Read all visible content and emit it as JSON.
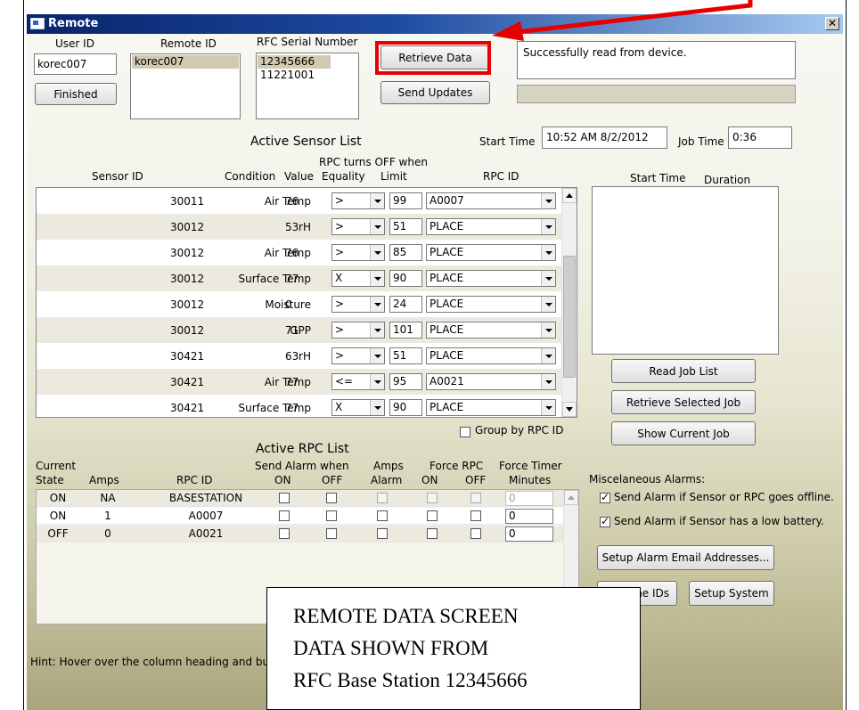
{
  "window": {
    "title": "Remote",
    "close_glyph": "✕"
  },
  "user": {
    "label": "User ID",
    "value": "korec007",
    "finished_label": "Finished"
  },
  "remote": {
    "label": "Remote ID",
    "items": [
      "korec007"
    ]
  },
  "rfc": {
    "label": "RFC Serial Number",
    "items": [
      "12345666",
      "11221001"
    ]
  },
  "buttons": {
    "retrieve": "Retrieve Data",
    "send": "Send Updates"
  },
  "status": {
    "message": "Successfully read from device."
  },
  "time": {
    "start_label": "Start Time",
    "start_value": "10:52 AM 8/2/2012",
    "job_label": "Job Time",
    "job_value": "0:36"
  },
  "sensor": {
    "title": "Active Sensor List",
    "header": {
      "id": "Sensor ID",
      "condition": "Condition",
      "value": "Value",
      "equality": "Equality",
      "limit": "Limit",
      "rpc": "RPC ID",
      "rpc_off": "RPC turns OFF when"
    },
    "rows": [
      {
        "id": "30011",
        "condition": "Air Temp",
        "value": "76",
        "equality": ">",
        "limit": "99",
        "rpc": "A0007"
      },
      {
        "id": "30012",
        "condition": "rH",
        "value": "53",
        "equality": ">",
        "limit": "51",
        "rpc": "PLACE"
      },
      {
        "id": "30012",
        "condition": "Air Temp",
        "value": "76",
        "equality": ">",
        "limit": "85",
        "rpc": "PLACE"
      },
      {
        "id": "30012",
        "condition": "Surface Temp",
        "value": "77",
        "equality": "X",
        "limit": "90",
        "rpc": "PLACE"
      },
      {
        "id": "30012",
        "condition": "Moisture",
        "value": "0",
        "equality": ">",
        "limit": "24",
        "rpc": "PLACE"
      },
      {
        "id": "30012",
        "condition": "GPP",
        "value": "71",
        "equality": ">",
        "limit": "101",
        "rpc": "PLACE"
      },
      {
        "id": "30421",
        "condition": "rH",
        "value": "63",
        "equality": ">",
        "limit": "51",
        "rpc": "PLACE"
      },
      {
        "id": "30421",
        "condition": "Air Temp",
        "value": "77",
        "equality": "<=",
        "limit": "95",
        "rpc": "A0021"
      },
      {
        "id": "30421",
        "condition": "Surface Temp",
        "value": "77",
        "equality": "X",
        "limit": "90",
        "rpc": "PLACE"
      }
    ],
    "group_label": "Group by RPC ID"
  },
  "jobs": {
    "start_header": "Start Time",
    "duration_header": "Duration",
    "read_label": "Read Job List",
    "retrieve_label": "Retrieve Selected Job",
    "show_label": "Show Current Job"
  },
  "rpc": {
    "title": "Active RPC List",
    "header": {
      "current": "Current",
      "state": "State",
      "amps": "Amps",
      "rpc_id": "RPC ID",
      "send_alarm": "Send Alarm when",
      "on": "ON",
      "off": "OFF",
      "amps_top": "Amps",
      "alarm": "Alarm",
      "force_rpc": "Force RPC",
      "force_on": "ON",
      "force_off": "OFF",
      "force_timer": "Force Timer",
      "minutes": "Minutes"
    },
    "rows": [
      {
        "state": "ON",
        "amps": "NA",
        "rpc": "BASESTATION",
        "timer": "0"
      },
      {
        "state": "ON",
        "amps": "1",
        "rpc": "A0007",
        "timer": "0"
      },
      {
        "state": "OFF",
        "amps": "0",
        "rpc": "A0021",
        "timer": "0"
      }
    ]
  },
  "misc": {
    "title": "Miscelaneous Alarms:",
    "offline": "Send Alarm if Sensor or RPC goes offline.",
    "battery": "Send Alarm if Sensor has a low battery.",
    "email": "Setup Alarm Email Addresses...",
    "rename": "Rename IDs",
    "setup": "Setup System"
  },
  "hint": "Hint: Hover over the column heading and bu",
  "overlay": {
    "line1": "REMOTE DATA SCREEN",
    "line2": "DATA SHOWN FROM",
    "line3": "RFC Base Station 12345666"
  },
  "colors": {
    "highlight": "#e60000",
    "title_start": "#08246b",
    "title_end": "#a6caf0",
    "selection": "#cfcab0"
  }
}
